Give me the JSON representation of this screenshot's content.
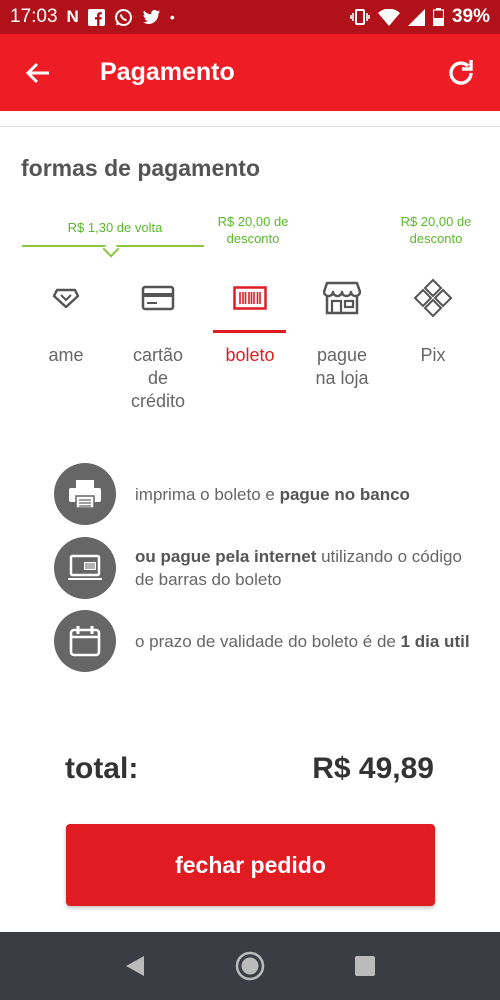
{
  "status_bar": {
    "time": "17:03",
    "battery": "39%"
  },
  "header": {
    "title": "Pagamento"
  },
  "section_title": "formas de pagamento",
  "promos": [
    {
      "text": "R$ 1,30 de volta"
    },
    {
      "line1": "R$ 20,00 de",
      "line2": "desconto"
    },
    {
      "line1": "R$ 20,00 de",
      "line2": "desconto"
    }
  ],
  "methods": [
    {
      "lines": [
        "ame"
      ]
    },
    {
      "lines": [
        "cartão",
        "de",
        "crédito"
      ]
    },
    {
      "lines": [
        "boleto"
      ]
    },
    {
      "lines": [
        "pague",
        "na loja"
      ]
    },
    {
      "lines": [
        "Pix"
      ]
    }
  ],
  "info": [
    {
      "normal1": "imprima o boleto e ",
      "bold": "pague no banco",
      "normal2": ""
    },
    {
      "bold": "ou pague pela internet",
      "normal1": " utilizando o código de barras do boleto"
    },
    {
      "normal1": "o prazo de validade do boleto é de ",
      "bold": "1 dia util"
    }
  ],
  "total": {
    "label": "total:",
    "value": "R$ 49,89"
  },
  "cta": {
    "label": "fechar pedido"
  },
  "colors": {
    "brand_red": "#ee1c25",
    "active": "#e11b22",
    "promo_green": "#5ab92a"
  }
}
